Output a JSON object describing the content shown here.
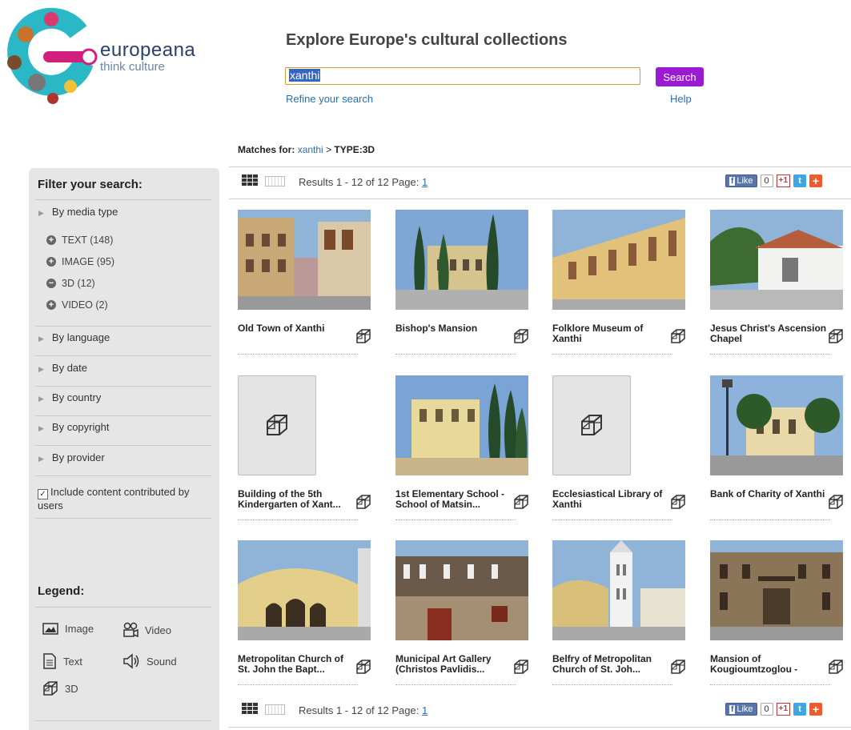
{
  "header": {
    "brand_name": "europeana",
    "brand_tagline": "think culture",
    "title": "Explore Europe's cultural collections",
    "search_value": "xanthi",
    "search_button": "Search",
    "refine_link": "Refine your search",
    "help_link": "Help"
  },
  "breadcrumb": {
    "prefix": "Matches for:",
    "query": "xanthi",
    "sep": ">",
    "type": "TYPE:3D"
  },
  "sidebar": {
    "filter_heading": "Filter your search:",
    "media_type": "By media type",
    "facets": [
      {
        "label": "TEXT (148)",
        "state": "+"
      },
      {
        "label": "IMAGE (95)",
        "state": "+"
      },
      {
        "label": "3D (12)",
        "state": "−"
      },
      {
        "label": "VIDEO (2)",
        "state": "+"
      }
    ],
    "filters": [
      "By language",
      "By date",
      "By country",
      "By copyright",
      "By provider"
    ],
    "include_label": "Include content contributed by users",
    "legend_heading": "Legend:",
    "legend": {
      "image": "Image",
      "video": "Video",
      "text": "Text",
      "sound": "Sound",
      "three_d": "3D"
    }
  },
  "results": {
    "label": "Results 1 - 12 of 12 Page:",
    "page": "1",
    "like": "Like",
    "like_count": "0",
    "gplus": "+1"
  },
  "items": [
    {
      "title": "Old Town of Xanthi",
      "thumb": "photo"
    },
    {
      "title": "Bishop's Mansion",
      "thumb": "photo"
    },
    {
      "title": "Folklore Museum of Xanthi",
      "thumb": "photo"
    },
    {
      "title": "Jesus Christ's Ascension Chapel",
      "thumb": "photo"
    },
    {
      "title": "Building of the 5th Kindergarten of Xant...",
      "thumb": "placeholder"
    },
    {
      "title": "1st Elementary School - School of Matsin...",
      "thumb": "photo"
    },
    {
      "title": "Ecclesiastical Library of Xanthi",
      "thumb": "placeholder"
    },
    {
      "title": "Bank of Charity of Xanthi",
      "thumb": "photo"
    },
    {
      "title": "Metropolitan Church of St. John the Bapt...",
      "thumb": "photo"
    },
    {
      "title": "Municipal Art Gallery (Christos Pavlidis...",
      "thumb": "photo"
    },
    {
      "title": "Belfry of Metropolitan Church of St. Joh...",
      "thumb": "photo"
    },
    {
      "title": "Mansion of Kougioumtzoglou -",
      "thumb": "photo"
    }
  ],
  "colors": {
    "search_button": "#9b1bd2",
    "link": "#2a6db5",
    "sidebar_bg": "#e6e6e6"
  }
}
